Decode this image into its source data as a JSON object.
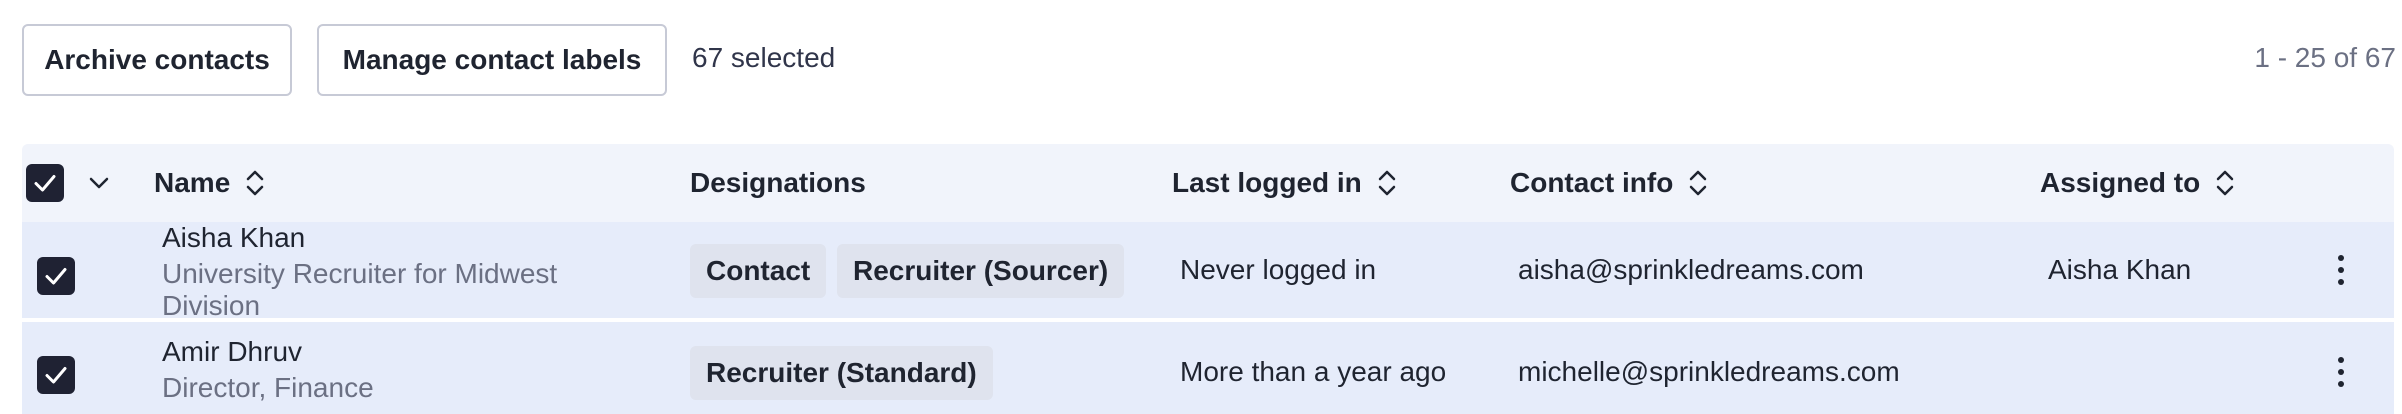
{
  "toolbar": {
    "archive_label": "Archive contacts",
    "manage_labels_label": "Manage contact labels",
    "selected_text": "67 selected",
    "pagination_text": "1 - 25 of 67"
  },
  "table": {
    "columns": {
      "name": "Name",
      "designations": "Designations",
      "last_logged_in": "Last logged in",
      "contact_info": "Contact info",
      "assigned_to": "Assigned to"
    },
    "rows": [
      {
        "selected": true,
        "name": "Aisha Khan",
        "title": "University Recruiter for Midwest Division",
        "designations": [
          "Contact",
          "Recruiter (Sourcer)"
        ],
        "last_logged_in": "Never logged in",
        "contact": "aisha@sprinkledreams.com",
        "assigned_to": "Aisha Khan"
      },
      {
        "selected": true,
        "name": "Amir Dhruv",
        "title": "Director, Finance",
        "designations": [
          "Recruiter (Standard)"
        ],
        "last_logged_in": "More than a year ago",
        "contact": "michelle@sprinkledreams.com",
        "assigned_to": ""
      }
    ]
  },
  "icons": {
    "checkbox": "checkmark-icon",
    "select_menu": "chevron-down-icon",
    "sort": "sort-updown-icon",
    "row_menu": "kebab-menu-icon"
  },
  "colors": {
    "header_bg": "#f1f4fb",
    "row_bg": "#e6ecfa",
    "checkbox_bg": "#1f2233",
    "tag_bg": "#dfe3ee",
    "muted_text": "#6b7083"
  }
}
